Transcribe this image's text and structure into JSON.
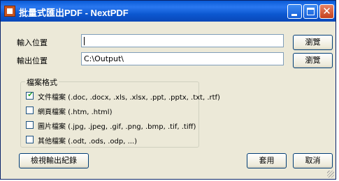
{
  "window": {
    "title": "批量式匯出PDF - NextPDF",
    "icon": "nextpdf-app-icon",
    "controls": {
      "minimize": "minimize-icon",
      "maximize": "maximize-icon",
      "close": "close-icon",
      "close_glyph": "✕"
    }
  },
  "form": {
    "input_location": {
      "label": "輸入位置",
      "value": ""
    },
    "output_location": {
      "label": "輸出位置",
      "value": "C:\\Output\\"
    },
    "browse_label": "瀏覽"
  },
  "file_format": {
    "group_title": "檔案格式",
    "options": [
      {
        "label": "文件檔案 (.doc, .docx, .xls, .xlsx, .ppt, .pptx, .txt, .rtf)",
        "checked": true
      },
      {
        "label": "網頁檔案 (.htm, .html)",
        "checked": false
      },
      {
        "label": "圖片檔案 (.jpg, .jpeg, .gif, .png, .bmp, .tif, .tiff)",
        "checked": false
      },
      {
        "label": "其他檔案 (.odt, .ods, .odp, ...)",
        "checked": false
      }
    ]
  },
  "footer": {
    "view_log_label": "檢視輸出紀錄",
    "apply_label": "套用",
    "cancel_label": "取消"
  },
  "colors": {
    "titlebar": "#0b57d0",
    "dialog_bg": "#ece9d8",
    "checkmark": "#21a121"
  }
}
